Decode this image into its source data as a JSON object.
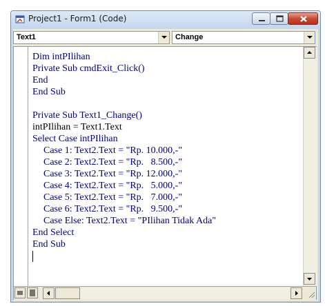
{
  "window": {
    "title": "Project1 - Form1 (Code)",
    "controls": {
      "minimize": "minimize-icon",
      "maximize": "maximize-icon",
      "close": "close-icon"
    }
  },
  "object_combo": {
    "value": "Text1"
  },
  "procedure_combo": {
    "value": "Change"
  },
  "code": {
    "lines": [
      "Dim intPIlihan",
      "Private Sub cmdExit_Click()",
      "End",
      "End Sub",
      "",
      "Private Sub Text1_Change()",
      "intPIlihan = Text1.Text",
      "Select Case intPIlihan",
      "Case 1: Text2.Text = \"Rp. 10.000,-\"",
      "Case 2: Text2.Text = \"Rp.   8.500,-\"",
      "Case 3: Text2.Text = \"Rp. 12.000,-\"",
      "Case 4: Text2.Text = \"Rp.   5.000,-\"",
      "Case 5: Text2.Text = \"Rp.   7.000,-\"",
      "Case 6: Text2.Text = \"Rp.   9.500,-\"",
      "Case Else: Text2.Text = \"PIlihan Tidak Ada\"",
      "End Select",
      "End Sub"
    ]
  },
  "colors": {
    "keyword": "#00007f",
    "text": "#000000",
    "titlebar": "#c8d8ec",
    "close_button": "#c94a32"
  }
}
